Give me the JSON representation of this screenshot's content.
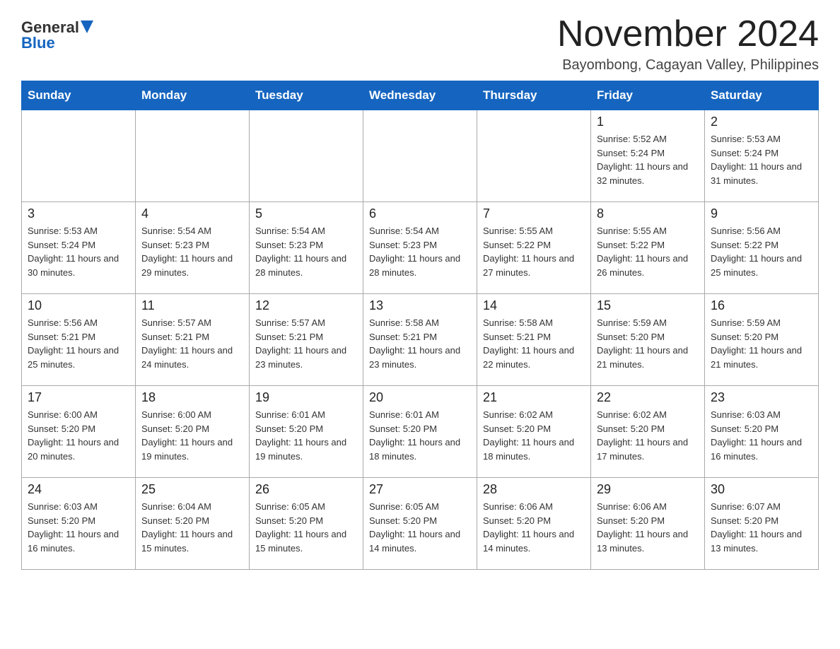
{
  "header": {
    "logo_general": "General",
    "logo_blue": "Blue",
    "main_title": "November 2024",
    "subtitle": "Bayombong, Cagayan Valley, Philippines"
  },
  "weekdays": [
    "Sunday",
    "Monday",
    "Tuesday",
    "Wednesday",
    "Thursday",
    "Friday",
    "Saturday"
  ],
  "weeks": [
    [
      {
        "day": "",
        "sunrise": "",
        "sunset": "",
        "daylight": ""
      },
      {
        "day": "",
        "sunrise": "",
        "sunset": "",
        "daylight": ""
      },
      {
        "day": "",
        "sunrise": "",
        "sunset": "",
        "daylight": ""
      },
      {
        "day": "",
        "sunrise": "",
        "sunset": "",
        "daylight": ""
      },
      {
        "day": "",
        "sunrise": "",
        "sunset": "",
        "daylight": ""
      },
      {
        "day": "1",
        "sunrise": "Sunrise: 5:52 AM",
        "sunset": "Sunset: 5:24 PM",
        "daylight": "Daylight: 11 hours and 32 minutes."
      },
      {
        "day": "2",
        "sunrise": "Sunrise: 5:53 AM",
        "sunset": "Sunset: 5:24 PM",
        "daylight": "Daylight: 11 hours and 31 minutes."
      }
    ],
    [
      {
        "day": "3",
        "sunrise": "Sunrise: 5:53 AM",
        "sunset": "Sunset: 5:24 PM",
        "daylight": "Daylight: 11 hours and 30 minutes."
      },
      {
        "day": "4",
        "sunrise": "Sunrise: 5:54 AM",
        "sunset": "Sunset: 5:23 PM",
        "daylight": "Daylight: 11 hours and 29 minutes."
      },
      {
        "day": "5",
        "sunrise": "Sunrise: 5:54 AM",
        "sunset": "Sunset: 5:23 PM",
        "daylight": "Daylight: 11 hours and 28 minutes."
      },
      {
        "day": "6",
        "sunrise": "Sunrise: 5:54 AM",
        "sunset": "Sunset: 5:23 PM",
        "daylight": "Daylight: 11 hours and 28 minutes."
      },
      {
        "day": "7",
        "sunrise": "Sunrise: 5:55 AM",
        "sunset": "Sunset: 5:22 PM",
        "daylight": "Daylight: 11 hours and 27 minutes."
      },
      {
        "day": "8",
        "sunrise": "Sunrise: 5:55 AM",
        "sunset": "Sunset: 5:22 PM",
        "daylight": "Daylight: 11 hours and 26 minutes."
      },
      {
        "day": "9",
        "sunrise": "Sunrise: 5:56 AM",
        "sunset": "Sunset: 5:22 PM",
        "daylight": "Daylight: 11 hours and 25 minutes."
      }
    ],
    [
      {
        "day": "10",
        "sunrise": "Sunrise: 5:56 AM",
        "sunset": "Sunset: 5:21 PM",
        "daylight": "Daylight: 11 hours and 25 minutes."
      },
      {
        "day": "11",
        "sunrise": "Sunrise: 5:57 AM",
        "sunset": "Sunset: 5:21 PM",
        "daylight": "Daylight: 11 hours and 24 minutes."
      },
      {
        "day": "12",
        "sunrise": "Sunrise: 5:57 AM",
        "sunset": "Sunset: 5:21 PM",
        "daylight": "Daylight: 11 hours and 23 minutes."
      },
      {
        "day": "13",
        "sunrise": "Sunrise: 5:58 AM",
        "sunset": "Sunset: 5:21 PM",
        "daylight": "Daylight: 11 hours and 23 minutes."
      },
      {
        "day": "14",
        "sunrise": "Sunrise: 5:58 AM",
        "sunset": "Sunset: 5:21 PM",
        "daylight": "Daylight: 11 hours and 22 minutes."
      },
      {
        "day": "15",
        "sunrise": "Sunrise: 5:59 AM",
        "sunset": "Sunset: 5:20 PM",
        "daylight": "Daylight: 11 hours and 21 minutes."
      },
      {
        "day": "16",
        "sunrise": "Sunrise: 5:59 AM",
        "sunset": "Sunset: 5:20 PM",
        "daylight": "Daylight: 11 hours and 21 minutes."
      }
    ],
    [
      {
        "day": "17",
        "sunrise": "Sunrise: 6:00 AM",
        "sunset": "Sunset: 5:20 PM",
        "daylight": "Daylight: 11 hours and 20 minutes."
      },
      {
        "day": "18",
        "sunrise": "Sunrise: 6:00 AM",
        "sunset": "Sunset: 5:20 PM",
        "daylight": "Daylight: 11 hours and 19 minutes."
      },
      {
        "day": "19",
        "sunrise": "Sunrise: 6:01 AM",
        "sunset": "Sunset: 5:20 PM",
        "daylight": "Daylight: 11 hours and 19 minutes."
      },
      {
        "day": "20",
        "sunrise": "Sunrise: 6:01 AM",
        "sunset": "Sunset: 5:20 PM",
        "daylight": "Daylight: 11 hours and 18 minutes."
      },
      {
        "day": "21",
        "sunrise": "Sunrise: 6:02 AM",
        "sunset": "Sunset: 5:20 PM",
        "daylight": "Daylight: 11 hours and 18 minutes."
      },
      {
        "day": "22",
        "sunrise": "Sunrise: 6:02 AM",
        "sunset": "Sunset: 5:20 PM",
        "daylight": "Daylight: 11 hours and 17 minutes."
      },
      {
        "day": "23",
        "sunrise": "Sunrise: 6:03 AM",
        "sunset": "Sunset: 5:20 PM",
        "daylight": "Daylight: 11 hours and 16 minutes."
      }
    ],
    [
      {
        "day": "24",
        "sunrise": "Sunrise: 6:03 AM",
        "sunset": "Sunset: 5:20 PM",
        "daylight": "Daylight: 11 hours and 16 minutes."
      },
      {
        "day": "25",
        "sunrise": "Sunrise: 6:04 AM",
        "sunset": "Sunset: 5:20 PM",
        "daylight": "Daylight: 11 hours and 15 minutes."
      },
      {
        "day": "26",
        "sunrise": "Sunrise: 6:05 AM",
        "sunset": "Sunset: 5:20 PM",
        "daylight": "Daylight: 11 hours and 15 minutes."
      },
      {
        "day": "27",
        "sunrise": "Sunrise: 6:05 AM",
        "sunset": "Sunset: 5:20 PM",
        "daylight": "Daylight: 11 hours and 14 minutes."
      },
      {
        "day": "28",
        "sunrise": "Sunrise: 6:06 AM",
        "sunset": "Sunset: 5:20 PM",
        "daylight": "Daylight: 11 hours and 14 minutes."
      },
      {
        "day": "29",
        "sunrise": "Sunrise: 6:06 AM",
        "sunset": "Sunset: 5:20 PM",
        "daylight": "Daylight: 11 hours and 13 minutes."
      },
      {
        "day": "30",
        "sunrise": "Sunrise: 6:07 AM",
        "sunset": "Sunset: 5:20 PM",
        "daylight": "Daylight: 11 hours and 13 minutes."
      }
    ]
  ]
}
